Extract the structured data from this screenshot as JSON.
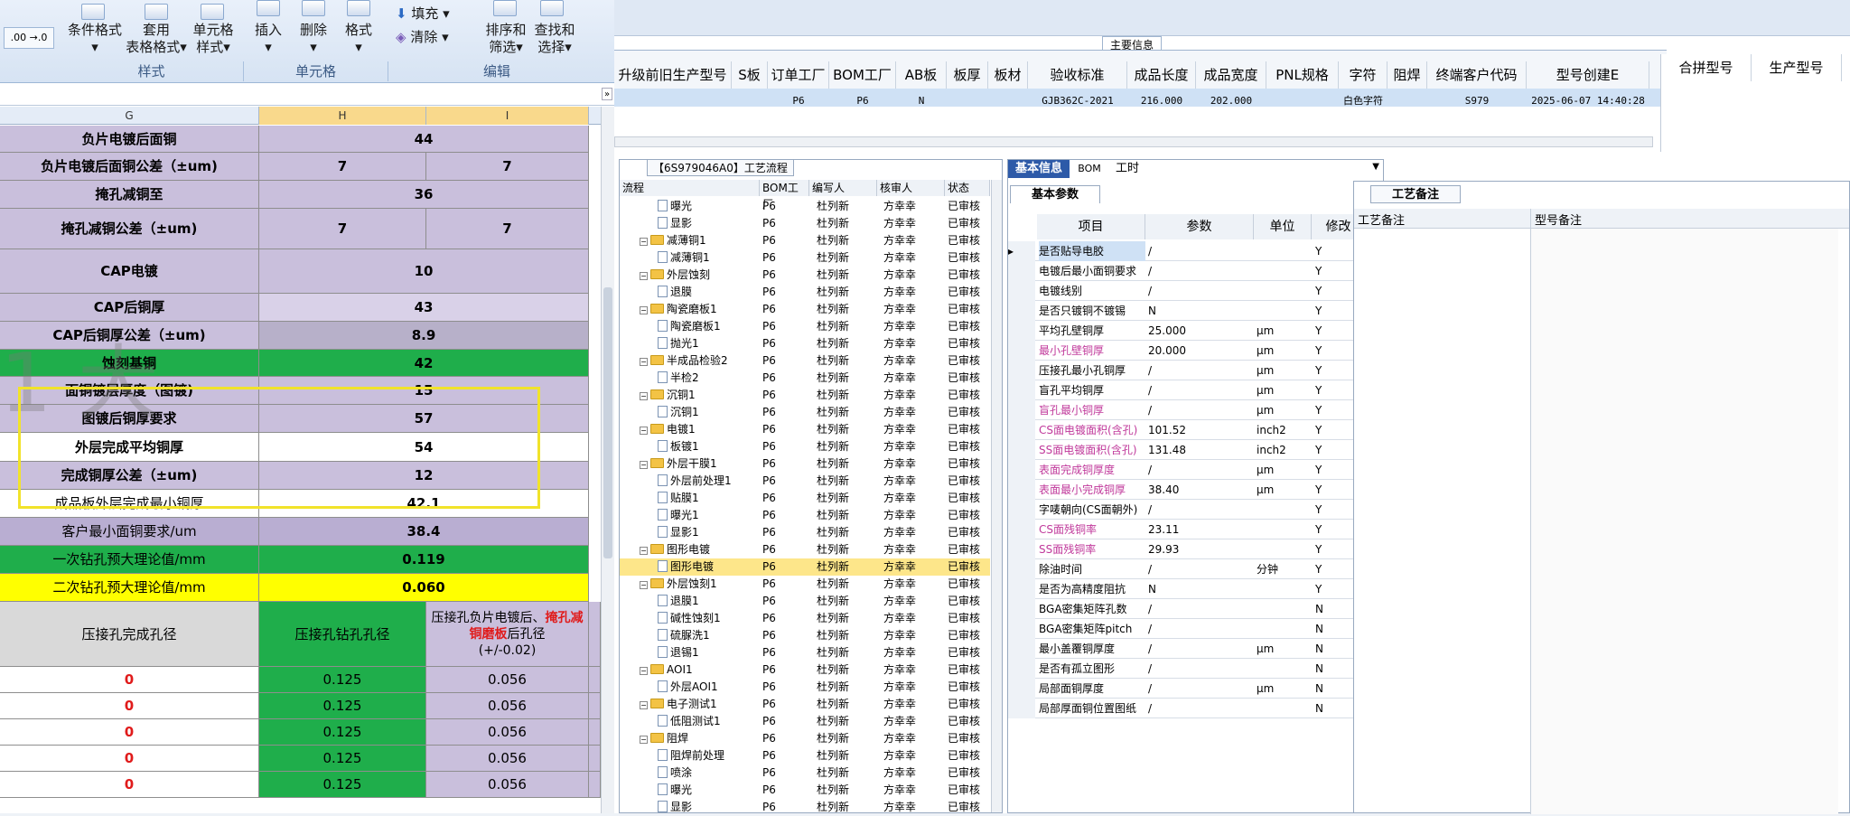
{
  "ribbon": {
    "cond_format": "条件格式",
    "table_format_1": "套用",
    "table_format_2": "表格格式",
    "cell_style_1": "单元格",
    "cell_style_2": "样式",
    "insert": "插入",
    "delete": "删除",
    "format": "格式",
    "fill": "填充",
    "clear": "清除",
    "sort_1": "排序和",
    "sort_2": "筛选",
    "find_1": "查找和",
    "find_2": "选择",
    "group_style": "样式",
    "group_cells": "单元格",
    "group_edit": "编辑",
    "num_fmt": ".00 →.0"
  },
  "sheet": {
    "col_g": "G",
    "col_h": "H",
    "col_i": "I",
    "rows": [
      {
        "label": "负片电镀后面铜",
        "merged": "44"
      },
      {
        "label": "负片电镀后面铜公差（±um)",
        "h": "7",
        "i": "7"
      },
      {
        "label": "掩孔减铜至",
        "merged": "36"
      },
      {
        "label": "掩孔减铜公差（±um)",
        "h": "7",
        "i": "7"
      },
      {
        "label": "CAP电镀",
        "merged": "10"
      },
      {
        "label": "CAP后铜厚",
        "merged": "43"
      },
      {
        "label": "CAP后铜厚公差（±um)",
        "merged": "8.9"
      },
      {
        "label": "蚀刻基铜",
        "merged": "42"
      },
      {
        "label": "面铜镀层厚度（图镀)",
        "merged": "15"
      },
      {
        "label": "图镀后铜厚要求",
        "merged": "57"
      },
      {
        "label": "外层完成平均铜厚",
        "merged": "54"
      },
      {
        "label": "完成铜厚公差（±um)",
        "merged": "12"
      },
      {
        "label": "成品板外层完成最小铜厚",
        "merged": "42.1"
      },
      {
        "label": "客户最小面铜要求/um",
        "merged": "38.4"
      },
      {
        "label": "一次钻孔预大理论值/mm",
        "merged": "0.119"
      },
      {
        "label": "二次钻孔预大理论值/mm",
        "merged": "0.060"
      }
    ],
    "hdr_g": "压接孔完成孔径",
    "hdr_h": "压接孔钻孔孔径",
    "hdr_i_1": "压接孔负片电镀后、",
    "hdr_i_red": "掩孔减铜磨板",
    "hdr_i_2": "后孔径",
    "hdr_i_3": "(+/-0.02)",
    "data_rows": [
      {
        "g": "0",
        "h": "0.125",
        "i": "0.056"
      },
      {
        "g": "0",
        "h": "0.125",
        "i": "0.056"
      },
      {
        "g": "0",
        "h": "0.125",
        "i": "0.056"
      },
      {
        "g": "0",
        "h": "0.125",
        "i": "0.056"
      },
      {
        "g": "0",
        "h": "0.125",
        "i": "0.056"
      }
    ]
  },
  "main": {
    "section_label": "主要信息",
    "headers": [
      "升级前旧生产型号",
      "S板",
      "订单工厂",
      "BOM工厂",
      "AB板",
      "板厚",
      "板材",
      "验收标准",
      "成品长度",
      "成品宽度",
      "PNL规格",
      "字符",
      "阻焊",
      "终端客户代码",
      "型号创建E"
    ],
    "values": [
      "",
      "",
      "P6",
      "P6",
      "N",
      "",
      "",
      "GJB362C-2021",
      "216.000",
      "202.000",
      "",
      "白色字符",
      "",
      "S979",
      "2025-06-07 14:40:28"
    ],
    "right_headers": [
      "合拼型号",
      "生产型号"
    ]
  },
  "flow": {
    "title": "【6S979046A0】工艺流程",
    "headers": [
      "流程",
      "BOM工厂",
      "编写人",
      "核审人",
      "状态"
    ],
    "rows": [
      {
        "name": "曝光",
        "lvl": 2,
        "type": "doc",
        "f": "P6",
        "w": "杜列新",
        "r": "方幸幸",
        "s": "已审核"
      },
      {
        "name": "显影",
        "lvl": 2,
        "type": "doc",
        "f": "P6",
        "w": "杜列新",
        "r": "方幸幸",
        "s": "已审核"
      },
      {
        "name": "减薄铜1",
        "lvl": 1,
        "type": "fold",
        "f": "P6",
        "w": "杜列新",
        "r": "方幸幸",
        "s": "已审核"
      },
      {
        "name": "减薄铜1",
        "lvl": 2,
        "type": "doc",
        "f": "P6",
        "w": "杜列新",
        "r": "方幸幸",
        "s": "已审核"
      },
      {
        "name": "外层蚀刻",
        "lvl": 1,
        "type": "fold",
        "f": "P6",
        "w": "杜列新",
        "r": "方幸幸",
        "s": "已审核"
      },
      {
        "name": "退膜",
        "lvl": 2,
        "type": "doc",
        "f": "P6",
        "w": "杜列新",
        "r": "方幸幸",
        "s": "已审核"
      },
      {
        "name": "陶瓷磨板1",
        "lvl": 1,
        "type": "fold",
        "f": "P6",
        "w": "杜列新",
        "r": "方幸幸",
        "s": "已审核"
      },
      {
        "name": "陶瓷磨板1",
        "lvl": 2,
        "type": "doc",
        "f": "P6",
        "w": "杜列新",
        "r": "方幸幸",
        "s": "已审核"
      },
      {
        "name": "抛光1",
        "lvl": 2,
        "type": "doc",
        "f": "P6",
        "w": "杜列新",
        "r": "方幸幸",
        "s": "已审核"
      },
      {
        "name": "半成品检验2",
        "lvl": 1,
        "type": "fold",
        "f": "P6",
        "w": "杜列新",
        "r": "方幸幸",
        "s": "已审核"
      },
      {
        "name": "半检2",
        "lvl": 2,
        "type": "doc",
        "f": "P6",
        "w": "杜列新",
        "r": "方幸幸",
        "s": "已审核"
      },
      {
        "name": "沉铜1",
        "lvl": 1,
        "type": "fold",
        "f": "P6",
        "w": "杜列新",
        "r": "方幸幸",
        "s": "已审核"
      },
      {
        "name": "沉铜1",
        "lvl": 2,
        "type": "doc",
        "f": "P6",
        "w": "杜列新",
        "r": "方幸幸",
        "s": "已审核"
      },
      {
        "name": "电镀1",
        "lvl": 1,
        "type": "fold",
        "f": "P6",
        "w": "杜列新",
        "r": "方幸幸",
        "s": "已审核"
      },
      {
        "name": "板镀1",
        "lvl": 2,
        "type": "doc",
        "f": "P6",
        "w": "杜列新",
        "r": "方幸幸",
        "s": "已审核"
      },
      {
        "name": "外层干膜1",
        "lvl": 1,
        "type": "fold",
        "f": "P6",
        "w": "杜列新",
        "r": "方幸幸",
        "s": "已审核"
      },
      {
        "name": "外层前处理1",
        "lvl": 2,
        "type": "doc",
        "f": "P6",
        "w": "杜列新",
        "r": "方幸幸",
        "s": "已审核"
      },
      {
        "name": "贴膜1",
        "lvl": 2,
        "type": "doc",
        "f": "P6",
        "w": "杜列新",
        "r": "方幸幸",
        "s": "已审核"
      },
      {
        "name": "曝光1",
        "lvl": 2,
        "type": "doc",
        "f": "P6",
        "w": "杜列新",
        "r": "方幸幸",
        "s": "已审核"
      },
      {
        "name": "显影1",
        "lvl": 2,
        "type": "doc",
        "f": "P6",
        "w": "杜列新",
        "r": "方幸幸",
        "s": "已审核"
      },
      {
        "name": "图形电镀",
        "lvl": 1,
        "type": "fold",
        "f": "P6",
        "w": "杜列新",
        "r": "方幸幸",
        "s": "已审核"
      },
      {
        "name": "图形电镀",
        "lvl": 2,
        "type": "doc",
        "f": "P6",
        "w": "杜列新",
        "r": "方幸幸",
        "s": "已审核",
        "sel": true
      },
      {
        "name": "外层蚀刻1",
        "lvl": 1,
        "type": "fold",
        "f": "P6",
        "w": "杜列新",
        "r": "方幸幸",
        "s": "已审核"
      },
      {
        "name": "退膜1",
        "lvl": 2,
        "type": "doc",
        "f": "P6",
        "w": "杜列新",
        "r": "方幸幸",
        "s": "已审核"
      },
      {
        "name": "碱性蚀刻1",
        "lvl": 2,
        "type": "doc",
        "f": "P6",
        "w": "杜列新",
        "r": "方幸幸",
        "s": "已审核"
      },
      {
        "name": "硫脲洗1",
        "lvl": 2,
        "type": "doc",
        "f": "P6",
        "w": "杜列新",
        "r": "方幸幸",
        "s": "已审核"
      },
      {
        "name": "退锡1",
        "lvl": 2,
        "type": "doc",
        "f": "P6",
        "w": "杜列新",
        "r": "方幸幸",
        "s": "已审核"
      },
      {
        "name": "AOI1",
        "lvl": 1,
        "type": "fold",
        "f": "P6",
        "w": "杜列新",
        "r": "方幸幸",
        "s": "已审核"
      },
      {
        "name": "外层AOI1",
        "lvl": 2,
        "type": "doc",
        "f": "P6",
        "w": "杜列新",
        "r": "方幸幸",
        "s": "已审核"
      },
      {
        "name": "电子测试1",
        "lvl": 1,
        "type": "fold",
        "f": "P6",
        "w": "杜列新",
        "r": "方幸幸",
        "s": "已审核"
      },
      {
        "name": "低阻测试1",
        "lvl": 2,
        "type": "doc",
        "f": "P6",
        "w": "杜列新",
        "r": "方幸幸",
        "s": "已审核"
      },
      {
        "name": "阻焊",
        "lvl": 1,
        "type": "fold",
        "f": "P6",
        "w": "杜列新",
        "r": "方幸幸",
        "s": "已审核"
      },
      {
        "name": "阻焊前处理",
        "lvl": 2,
        "type": "doc",
        "f": "P6",
        "w": "杜列新",
        "r": "方幸幸",
        "s": "已审核"
      },
      {
        "name": "喷涂",
        "lvl": 2,
        "type": "doc",
        "f": "P6",
        "w": "杜列新",
        "r": "方幸幸",
        "s": "已审核"
      },
      {
        "name": "曝光",
        "lvl": 2,
        "type": "doc",
        "f": "P6",
        "w": "杜列新",
        "r": "方幸幸",
        "s": "已审核"
      },
      {
        "name": "显影",
        "lvl": 2,
        "type": "doc",
        "f": "P6",
        "w": "杜列新",
        "r": "方幸幸",
        "s": "已审核"
      }
    ]
  },
  "basic": {
    "tabs": [
      "基本信息",
      "BOM",
      "工时"
    ],
    "subtab": "基本参数",
    "headers": [
      "项目",
      "参数",
      "单位",
      "修改"
    ],
    "rows": [
      {
        "item": "是否贴导电胶",
        "param": "/",
        "unit": "",
        "mod": "Y",
        "pink": false
      },
      {
        "item": "电镀后最小面铜要求",
        "param": "/",
        "unit": "",
        "mod": "Y",
        "pink": false
      },
      {
        "item": "电镀线别",
        "param": "/",
        "unit": "",
        "mod": "Y",
        "pink": false
      },
      {
        "item": "是否只镀铜不镀锡",
        "param": "N",
        "unit": "",
        "mod": "Y",
        "pink": false
      },
      {
        "item": "平均孔壁铜厚",
        "param": "25.000",
        "unit": "μm",
        "mod": "Y",
        "pink": false
      },
      {
        "item": "最小孔壁铜厚",
        "param": "20.000",
        "unit": "μm",
        "mod": "Y",
        "pink": true
      },
      {
        "item": "压接孔最小孔铜厚",
        "param": "/",
        "unit": "μm",
        "mod": "Y",
        "pink": false
      },
      {
        "item": "盲孔平均铜厚",
        "param": "/",
        "unit": "μm",
        "mod": "Y",
        "pink": false
      },
      {
        "item": "盲孔最小铜厚",
        "param": "/",
        "unit": "μm",
        "mod": "Y",
        "pink": true
      },
      {
        "item": "CS面电镀面积(含孔)",
        "param": "101.52",
        "unit": "inch2",
        "mod": "Y",
        "pink": true
      },
      {
        "item": "SS面电镀面积(含孔)",
        "param": "131.48",
        "unit": "inch2",
        "mod": "Y",
        "pink": true
      },
      {
        "item": "表面完成铜厚度",
        "param": "/",
        "unit": "μm",
        "mod": "Y",
        "pink": true
      },
      {
        "item": "表面最小完成铜厚",
        "param": "38.40",
        "unit": "μm",
        "mod": "Y",
        "pink": true
      },
      {
        "item": "字唛朝向(CS面朝外)",
        "param": "/",
        "unit": "",
        "mod": "Y",
        "pink": false
      },
      {
        "item": "CS面残铜率",
        "param": "23.11",
        "unit": "",
        "mod": "Y",
        "pink": true
      },
      {
        "item": "SS面残铜率",
        "param": "29.93",
        "unit": "",
        "mod": "Y",
        "pink": true
      },
      {
        "item": "除油时间",
        "param": "/",
        "unit": "分钟",
        "mod": "Y",
        "pink": false
      },
      {
        "item": "是否为高精度阻抗",
        "param": "N",
        "unit": "",
        "mod": "Y",
        "pink": false
      },
      {
        "item": "BGA密集矩阵孔数",
        "param": "/",
        "unit": "",
        "mod": "N",
        "pink": false
      },
      {
        "item": "BGA密集矩阵pitch",
        "param": "/",
        "unit": "",
        "mod": "N",
        "pink": false
      },
      {
        "item": "最小盖覆铜厚度",
        "param": "/",
        "unit": "μm",
        "mod": "N",
        "pink": false
      },
      {
        "item": "是否有孤立图形",
        "param": "/",
        "unit": "",
        "mod": "N",
        "pink": false
      },
      {
        "item": "局部面铜厚度",
        "param": "/",
        "unit": "μm",
        "mod": "N",
        "pink": false
      },
      {
        "item": "局部厚面铜位置图纸",
        "param": "/",
        "unit": "",
        "mod": "N",
        "pink": false
      }
    ]
  },
  "remark": {
    "tab": "工艺备注",
    "col1": "工艺备注",
    "col2": "型号备注"
  }
}
